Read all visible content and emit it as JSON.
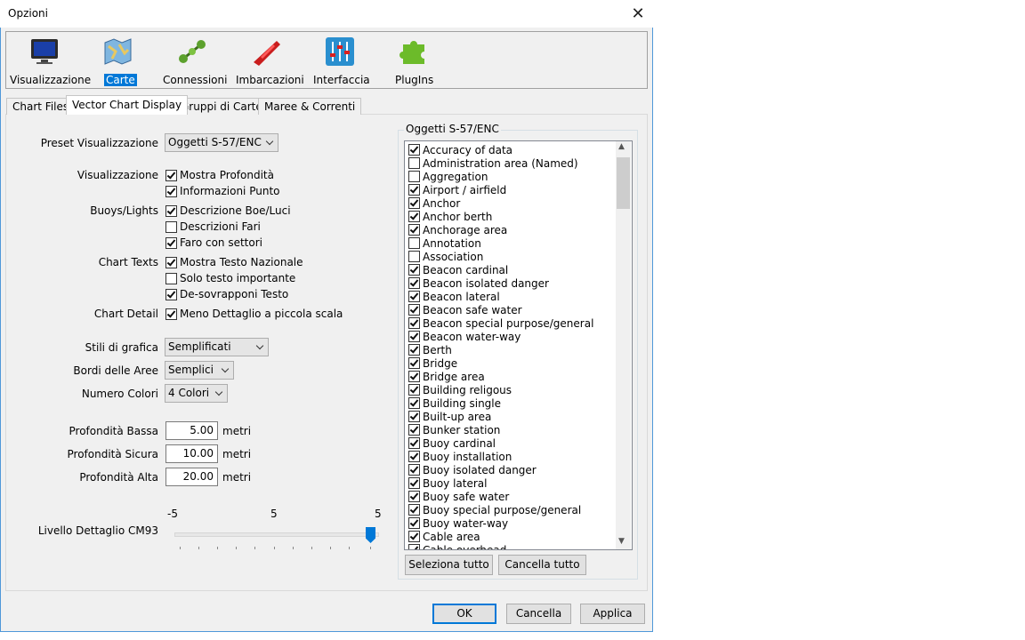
{
  "window": {
    "title": "Opzioni",
    "close_icon": "close-icon"
  },
  "toolbar": [
    {
      "label": "Visualizzazione",
      "icon": "monitor-icon",
      "selected": false
    },
    {
      "label": "Carte",
      "icon": "chart-map-icon",
      "selected": true
    },
    {
      "label": "Connessioni",
      "icon": "connections-icon",
      "selected": false
    },
    {
      "label": "Imbarcazioni",
      "icon": "boat-icon",
      "selected": false
    },
    {
      "label": "Interfaccia",
      "icon": "sliders-icon",
      "selected": false
    },
    {
      "label": "PlugIns",
      "icon": "puzzle-icon",
      "selected": false
    }
  ],
  "tabs": [
    {
      "label": "Chart Files",
      "active": false
    },
    {
      "label": "Vector Chart Display",
      "active": true
    },
    {
      "label": "Gruppi di Carte",
      "active": false
    },
    {
      "label": "Maree & Correnti",
      "active": false
    }
  ],
  "form": {
    "preset_label": "Preset Visualizzazione",
    "preset_value": "Oggetti S-57/ENC",
    "visualizzazione_label": "Visualizzazione",
    "mostra_profondita": {
      "label": "Mostra Profondità",
      "checked": true
    },
    "informazioni_punto": {
      "label": "Informazioni Punto",
      "checked": true
    },
    "buoys_label": "Buoys/Lights",
    "descrizione_boe": {
      "label": "Descrizione Boe/Luci",
      "checked": true
    },
    "descrizioni_fari": {
      "label": "Descrizioni Fari",
      "checked": false
    },
    "faro_settori": {
      "label": "Faro con settori",
      "checked": true
    },
    "chart_texts_label": "Chart Texts",
    "testo_nazionale": {
      "label": "Mostra Testo Nazionale",
      "checked": true
    },
    "solo_testo": {
      "label": "Solo testo importante",
      "checked": false
    },
    "desovrapponi": {
      "label": "De-sovrapponi Testo",
      "checked": true
    },
    "chart_detail_label": "Chart Detail",
    "meno_dettaglio": {
      "label": "Meno Dettaglio a piccola scala",
      "checked": true
    },
    "stili_label": "Stili di grafica",
    "stili_value": "Semplificati",
    "bordi_label": "Bordi delle Aree",
    "bordi_value": "Semplici",
    "colori_label": "Numero Colori",
    "colori_value": "4 Colori",
    "prof_bassa_label": "Profondità Bassa",
    "prof_bassa_value": "5.00",
    "prof_sicura_label": "Profondità Sicura",
    "prof_sicura_value": "10.00",
    "prof_alta_label": "Profondità Alta",
    "prof_alta_value": "20.00",
    "unit": "metri",
    "cm93_label": "Livello Dettaglio CM93",
    "slider_min": "-5",
    "slider_value": "5",
    "slider_max": "5",
    "slider_level": 5
  },
  "objects": {
    "title": "Oggetti S-57/ENC",
    "items": [
      {
        "label": "Accuracy of data",
        "checked": true
      },
      {
        "label": "Administration area (Named)",
        "checked": false
      },
      {
        "label": "Aggregation",
        "checked": false
      },
      {
        "label": "Airport / airfield",
        "checked": true
      },
      {
        "label": "Anchor",
        "checked": true
      },
      {
        "label": "Anchor berth",
        "checked": true
      },
      {
        "label": "Anchorage area",
        "checked": true
      },
      {
        "label": "Annotation",
        "checked": false
      },
      {
        "label": "Association",
        "checked": false
      },
      {
        "label": "Beacon cardinal",
        "checked": true
      },
      {
        "label": "Beacon isolated danger",
        "checked": true
      },
      {
        "label": "Beacon lateral",
        "checked": true
      },
      {
        "label": "Beacon safe water",
        "checked": true
      },
      {
        "label": "Beacon special purpose/general",
        "checked": true
      },
      {
        "label": "Beacon water-way",
        "checked": true
      },
      {
        "label": "Berth",
        "checked": true
      },
      {
        "label": "Bridge",
        "checked": true
      },
      {
        "label": "Bridge area",
        "checked": true
      },
      {
        "label": "Building religous",
        "checked": true
      },
      {
        "label": "Building single",
        "checked": true
      },
      {
        "label": "Built-up area",
        "checked": true
      },
      {
        "label": "Bunker station",
        "checked": true
      },
      {
        "label": "Buoy cardinal",
        "checked": true
      },
      {
        "label": "Buoy installation",
        "checked": true
      },
      {
        "label": "Buoy isolated danger",
        "checked": true
      },
      {
        "label": "Buoy lateral",
        "checked": true
      },
      {
        "label": "Buoy safe water",
        "checked": true
      },
      {
        "label": "Buoy special purpose/general",
        "checked": true
      },
      {
        "label": "Buoy water-way",
        "checked": true
      },
      {
        "label": "Cable area",
        "checked": true
      },
      {
        "label": "Cable overhead",
        "checked": true
      }
    ],
    "select_all": "Seleziona tutto",
    "clear_all": "Cancella tutto"
  },
  "footer": {
    "ok": "OK",
    "cancel": "Cancella",
    "apply": "Applica"
  }
}
